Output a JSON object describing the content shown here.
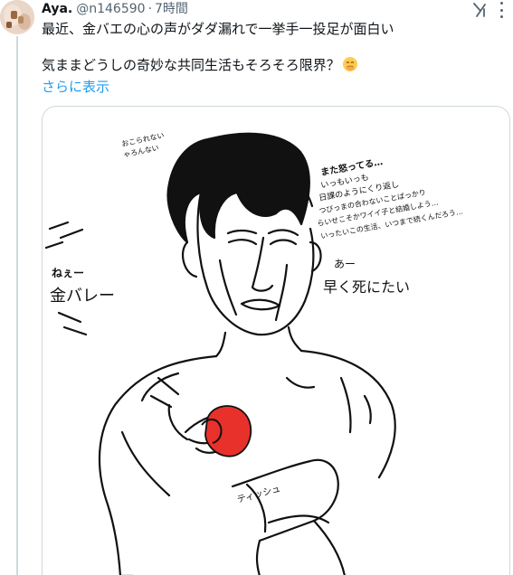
{
  "tweet": {
    "author_name": "Aya.",
    "handle": "@n146590",
    "separator": "·",
    "time": "7時間",
    "text_line1": "最近、金バエの心の声がダダ漏れで一挙手一投足が面白い",
    "text_line2": "気ままどうしの奇妙な共同生活もそろそろ限界？",
    "show_more": "さらに表示",
    "emoji": "face-with-hand-over-mouth-emoji"
  },
  "illustration": {
    "note_top": [
      "おこられない",
      "ゃろんない"
    ],
    "note_right": [
      "また怒ってる…",
      "いっもいっも",
      "日課のようにくり返し",
      "つびっまの合わないことばっかり",
      "らいせこそかワイイ子と結婚しよう…",
      "いったいこの生活、いつまで続くんだろう…"
    ],
    "cat_call_small": "ねぇー",
    "cat_call_big": "金バレー",
    "thought_small": "あー",
    "thought_big": "早く死にたい",
    "tissue": "ティッシュ"
  },
  "colors": {
    "link": "#1d9bf0",
    "secondary_text": "#536471",
    "border": "#cfd9de",
    "apple": "#e8312a"
  }
}
